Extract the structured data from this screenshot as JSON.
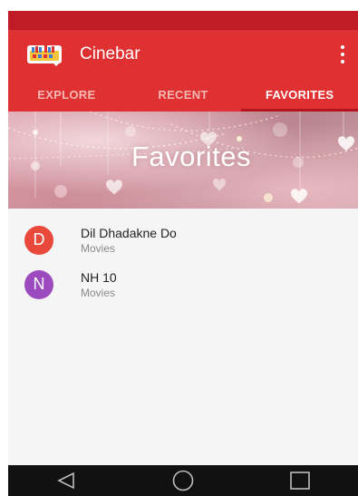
{
  "app": {
    "title": "Cinebar",
    "accent": "#e03132",
    "status_bar_color": "#c01c25"
  },
  "tabs": [
    {
      "label": "EXPLORE",
      "active": false
    },
    {
      "label": "RECENT",
      "active": false
    },
    {
      "label": "FAVORITES",
      "active": true
    }
  ],
  "banner": {
    "title": "Favorites"
  },
  "favorites": [
    {
      "initial": "D",
      "title": "Dil Dhadakne Do",
      "category": "Movies",
      "color": "#e8493b"
    },
    {
      "initial": "N",
      "title": "NH 10",
      "category": "Movies",
      "color": "#9c4bbf"
    }
  ],
  "navbar": {
    "icons": [
      "back-icon",
      "home-icon",
      "recents-icon"
    ]
  }
}
